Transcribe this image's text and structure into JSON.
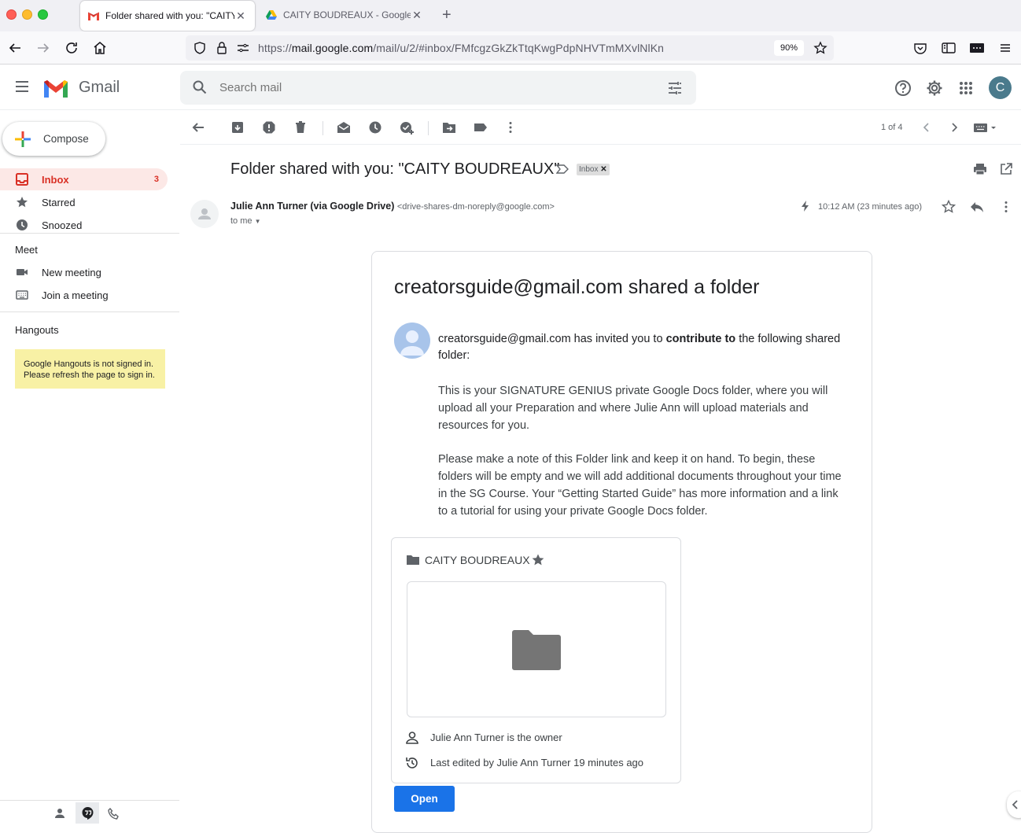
{
  "browser": {
    "tabs": [
      {
        "title": "Folder shared with you: \"CAITY BOUDREAUX\"",
        "active": true
      },
      {
        "title": "CAITY BOUDREAUX - Google Drive",
        "active": false
      }
    ],
    "url_prefix": "https://",
    "url_domain": "mail.google.com",
    "url_path": "/mail/u/2/#inbox/FMfcgzGkZkTtqKwgPdpNHVTmMXvlNlKn",
    "zoom": "90%"
  },
  "gmail": {
    "app_name": "Gmail",
    "search_placeholder": "Search mail",
    "account_initial": "C",
    "compose_label": "Compose",
    "nav": {
      "inbox": {
        "label": "Inbox",
        "count": "3"
      },
      "starred": {
        "label": "Starred"
      },
      "snoozed": {
        "label": "Snoozed"
      }
    },
    "meet": {
      "title": "Meet",
      "new_meeting": "New meeting",
      "join_meeting": "Join a meeting"
    },
    "hangouts": {
      "title": "Hangouts",
      "note_line1": "Google Hangouts is not signed in.",
      "note_line2": "Please refresh the page to sign in."
    },
    "toolbar": {
      "pager": "1 of 4"
    }
  },
  "message": {
    "subject": "Folder shared with you: \"CAITY BOUDREAUX\"",
    "label_chip": "Inbox",
    "sender_name": "Julie Ann Turner (via Google Drive)",
    "sender_email": "<drive-shares-dm-noreply@google.com>",
    "to": "to me",
    "time": "10:12 AM (23 minutes ago)"
  },
  "email_body": {
    "title": "creatorsguide@gmail.com shared a folder",
    "invite_prefix": "creatorsguide@gmail.com has invited you to ",
    "invite_bold": "contribute to",
    "invite_suffix": " the following shared folder:",
    "note1": "This is your SIGNATURE GENIUS private Google Docs folder, where you will upload all your Preparation and where Julie Ann will upload materials and resources for you.",
    "note2": "Please make a note of this Folder link and keep it on hand. To begin, these folders will be empty and we will add additional documents throughout your time in the SG Course. Your “Getting Started Guide” has more information and a link to a tutorial for using your private Google Docs folder.",
    "folder_name": "CAITY BOUDREAUX",
    "owner_text": "Julie Ann Turner is the owner",
    "last_edited": "Last edited by Julie Ann Turner 19 minutes ago",
    "open_button": "Open"
  },
  "colors": {
    "accent": "#1a73e8",
    "inbox_active": "#d93025",
    "note_bg": "#f8f1a5"
  },
  "icons": [
    "back-arrow-icon",
    "forward-arrow-icon",
    "reload-icon",
    "home-icon",
    "shield-icon",
    "lock-icon",
    "permissions-icon",
    "bookmark-star-icon",
    "pocket-icon",
    "sidebar-icon",
    "extension-icon",
    "app-menu-icon",
    "hamburger-menu-icon",
    "search-icon",
    "search-options-icon",
    "help-icon",
    "gear-icon",
    "apps-grid-icon",
    "archive-icon",
    "spam-icon",
    "trash-icon",
    "mark-unread-icon",
    "snooze-icon",
    "add-task-icon",
    "move-to-icon",
    "label-icon",
    "more-icon",
    "prev-icon",
    "next-icon",
    "keyboard-icon",
    "print-icon",
    "open-new-window-icon",
    "important-marker-icon",
    "star-icon",
    "reply-icon",
    "folder-icon",
    "person-icon",
    "history-icon"
  ]
}
